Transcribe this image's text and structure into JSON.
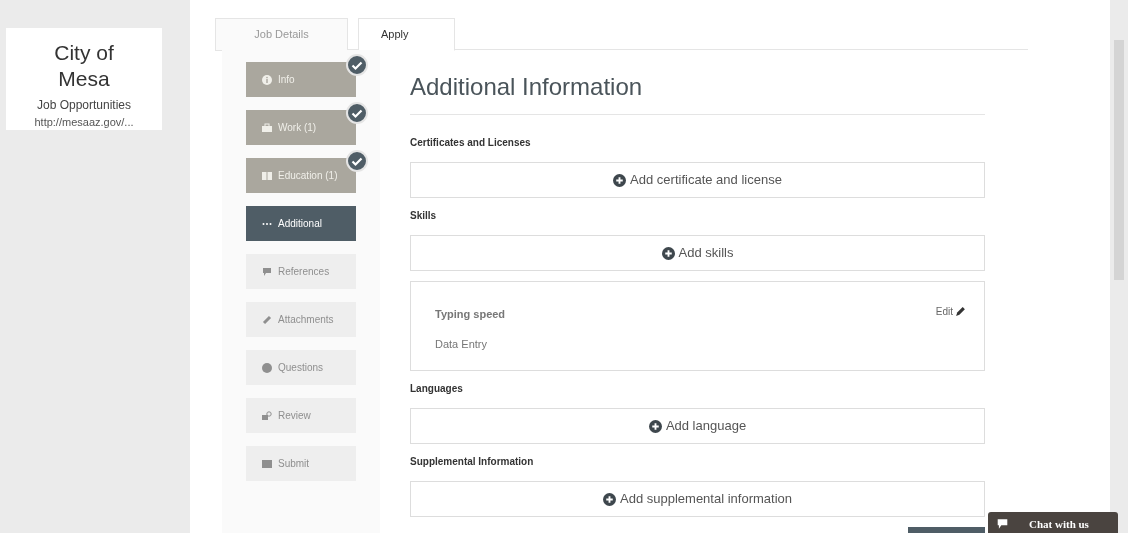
{
  "org_card": {
    "title_line1": "City of",
    "title_line2": "Mesa",
    "subtitle": "Job Opportunities",
    "url": "http://mesaaz.gov/..."
  },
  "tabs": [
    {
      "label": "Job Details",
      "selected": false
    },
    {
      "label": "Apply",
      "selected": true
    }
  ],
  "steps": [
    {
      "label": "Info",
      "completed": true,
      "selected": false,
      "disabled": false
    },
    {
      "label": "Work (1)",
      "completed": true,
      "selected": false,
      "disabled": false
    },
    {
      "label": "Education (1)",
      "completed": true,
      "selected": false,
      "disabled": false
    },
    {
      "label": "Additional",
      "completed": false,
      "selected": true,
      "disabled": false
    },
    {
      "label": "References",
      "completed": false,
      "selected": false,
      "disabled": true
    },
    {
      "label": "Attachments",
      "completed": false,
      "selected": false,
      "disabled": true
    },
    {
      "label": "Questions",
      "completed": false,
      "selected": false,
      "disabled": true
    },
    {
      "label": "Review",
      "completed": false,
      "selected": false,
      "disabled": true
    },
    {
      "label": "Submit",
      "completed": false,
      "selected": false,
      "disabled": true
    }
  ],
  "heading": "Additional Information",
  "sections": [
    {
      "title": "Certificates and Licenses",
      "add_label": "Add certificate and license"
    },
    {
      "title": "Skills",
      "add_label": "Add skills",
      "entry": {
        "name": "Typing speed",
        "detail": "Data Entry",
        "edit_label": "Edit"
      }
    },
    {
      "title": "Languages",
      "add_label": "Add language"
    },
    {
      "title": "Supplemental Information",
      "add_label": "Add supplemental information"
    }
  ],
  "chat": {
    "label": "Chat with us"
  }
}
